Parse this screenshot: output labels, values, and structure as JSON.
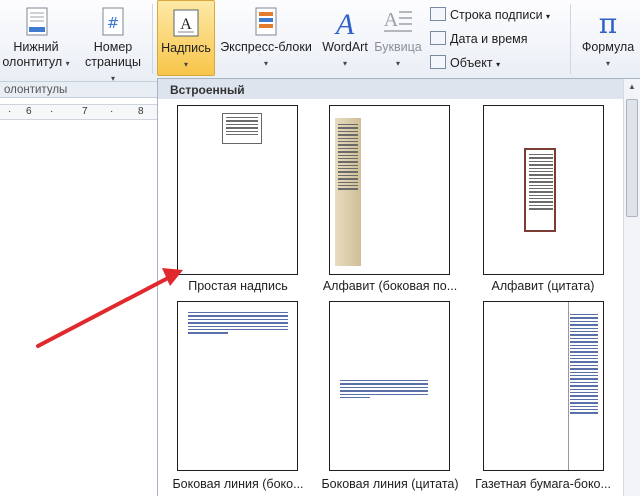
{
  "ribbon": {
    "footer_btn": {
      "line1": "Нижний",
      "line2": "олонтитул"
    },
    "pagenum_btn": {
      "line1": "Номер",
      "line2": "страницы"
    },
    "textbox_btn": {
      "label": "Надпись"
    },
    "quickparts_btn": {
      "label": "Экспресс-блоки"
    },
    "wordart_btn": {
      "label": "WordArt"
    },
    "dropcap_btn": {
      "label": "Буквица"
    },
    "signature_line": {
      "label": "Строка подписи"
    },
    "date_time": {
      "label": "Дата и время"
    },
    "object": {
      "label": "Объект"
    },
    "formula_btn": {
      "label": "Формула"
    },
    "group_header_footer": "олонтитулы"
  },
  "ruler": {
    "marks": [
      "6",
      "7",
      "8"
    ]
  },
  "gallery": {
    "header": "Встроенный",
    "items": [
      {
        "label": "Простая надпись"
      },
      {
        "label": "Алфавит (боковая по..."
      },
      {
        "label": "Алфавит (цитата)"
      },
      {
        "label": "Боковая линия (боко..."
      },
      {
        "label": "Боковая линия (цитата)"
      },
      {
        "label": "Газетная бумага-боко..."
      }
    ]
  },
  "colors": {
    "accent_arrow": "#e0282d",
    "selected_button": "#f8c54a",
    "sidebar_tan": "#d9ccab"
  },
  "icons": [
    "footer-icon",
    "page-number-icon",
    "textbox-icon",
    "quick-parts-icon",
    "wordart-icon",
    "dropcap-icon",
    "signature-icon",
    "date-time-icon",
    "object-icon",
    "formula-icon"
  ]
}
